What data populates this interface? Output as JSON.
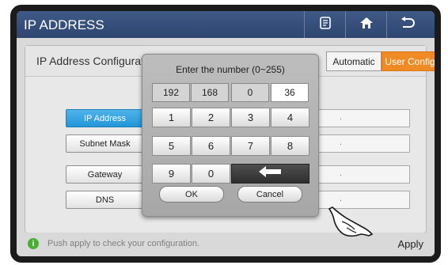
{
  "window": {
    "title": "IP ADDRESS",
    "icons": [
      "phone-note-icon",
      "home-icon",
      "back-icon"
    ]
  },
  "section": {
    "title": "IP Address Configurati",
    "modes": [
      "Automatic",
      "User Config"
    ],
    "selected_mode": "User Config"
  },
  "rows": [
    {
      "label": "IP Address",
      "active": true,
      "separator": "."
    },
    {
      "label": "Subnet Mask",
      "active": false,
      "separator": "."
    },
    {
      "label": "Gateway",
      "active": false,
      "separator": "."
    },
    {
      "label": "DNS",
      "active": false,
      "separator": "."
    }
  ],
  "keypad": {
    "title": "Enter the number (0~255)",
    "values": [
      "192",
      "168",
      "0",
      "36"
    ],
    "keys": [
      "1",
      "2",
      "3",
      "4",
      "5",
      "6",
      "7",
      "8",
      "9",
      "0"
    ],
    "backspace_icon": "left-arrow-icon",
    "ok_label": "OK",
    "cancel_label": "Cancel"
  },
  "footer": {
    "message": "Push apply to check your configuration.",
    "apply_label": "Apply"
  },
  "colors": {
    "titlebar": "#2e4670",
    "accent_orange": "#f08a24",
    "active_blue": "#2396d8",
    "info_green": "#4aad35"
  }
}
